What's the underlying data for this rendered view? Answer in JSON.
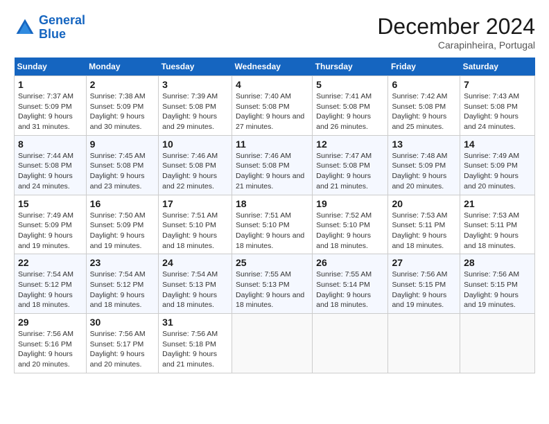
{
  "logo": {
    "line1": "General",
    "line2": "Blue"
  },
  "title": "December 2024",
  "location": "Carapinheira, Portugal",
  "days_header": [
    "Sunday",
    "Monday",
    "Tuesday",
    "Wednesday",
    "Thursday",
    "Friday",
    "Saturday"
  ],
  "weeks": [
    [
      {
        "day": "1",
        "sunrise": "Sunrise: 7:37 AM",
        "sunset": "Sunset: 5:09 PM",
        "daylight": "Daylight: 9 hours and 31 minutes."
      },
      {
        "day": "2",
        "sunrise": "Sunrise: 7:38 AM",
        "sunset": "Sunset: 5:09 PM",
        "daylight": "Daylight: 9 hours and 30 minutes."
      },
      {
        "day": "3",
        "sunrise": "Sunrise: 7:39 AM",
        "sunset": "Sunset: 5:08 PM",
        "daylight": "Daylight: 9 hours and 29 minutes."
      },
      {
        "day": "4",
        "sunrise": "Sunrise: 7:40 AM",
        "sunset": "Sunset: 5:08 PM",
        "daylight": "Daylight: 9 hours and 27 minutes."
      },
      {
        "day": "5",
        "sunrise": "Sunrise: 7:41 AM",
        "sunset": "Sunset: 5:08 PM",
        "daylight": "Daylight: 9 hours and 26 minutes."
      },
      {
        "day": "6",
        "sunrise": "Sunrise: 7:42 AM",
        "sunset": "Sunset: 5:08 PM",
        "daylight": "Daylight: 9 hours and 25 minutes."
      },
      {
        "day": "7",
        "sunrise": "Sunrise: 7:43 AM",
        "sunset": "Sunset: 5:08 PM",
        "daylight": "Daylight: 9 hours and 24 minutes."
      }
    ],
    [
      {
        "day": "8",
        "sunrise": "Sunrise: 7:44 AM",
        "sunset": "Sunset: 5:08 PM",
        "daylight": "Daylight: 9 hours and 24 minutes."
      },
      {
        "day": "9",
        "sunrise": "Sunrise: 7:45 AM",
        "sunset": "Sunset: 5:08 PM",
        "daylight": "Daylight: 9 hours and 23 minutes."
      },
      {
        "day": "10",
        "sunrise": "Sunrise: 7:46 AM",
        "sunset": "Sunset: 5:08 PM",
        "daylight": "Daylight: 9 hours and 22 minutes."
      },
      {
        "day": "11",
        "sunrise": "Sunrise: 7:46 AM",
        "sunset": "Sunset: 5:08 PM",
        "daylight": "Daylight: 9 hours and 21 minutes."
      },
      {
        "day": "12",
        "sunrise": "Sunrise: 7:47 AM",
        "sunset": "Sunset: 5:08 PM",
        "daylight": "Daylight: 9 hours and 21 minutes."
      },
      {
        "day": "13",
        "sunrise": "Sunrise: 7:48 AM",
        "sunset": "Sunset: 5:09 PM",
        "daylight": "Daylight: 9 hours and 20 minutes."
      },
      {
        "day": "14",
        "sunrise": "Sunrise: 7:49 AM",
        "sunset": "Sunset: 5:09 PM",
        "daylight": "Daylight: 9 hours and 20 minutes."
      }
    ],
    [
      {
        "day": "15",
        "sunrise": "Sunrise: 7:49 AM",
        "sunset": "Sunset: 5:09 PM",
        "daylight": "Daylight: 9 hours and 19 minutes."
      },
      {
        "day": "16",
        "sunrise": "Sunrise: 7:50 AM",
        "sunset": "Sunset: 5:09 PM",
        "daylight": "Daylight: 9 hours and 19 minutes."
      },
      {
        "day": "17",
        "sunrise": "Sunrise: 7:51 AM",
        "sunset": "Sunset: 5:10 PM",
        "daylight": "Daylight: 9 hours and 18 minutes."
      },
      {
        "day": "18",
        "sunrise": "Sunrise: 7:51 AM",
        "sunset": "Sunset: 5:10 PM",
        "daylight": "Daylight: 9 hours and 18 minutes."
      },
      {
        "day": "19",
        "sunrise": "Sunrise: 7:52 AM",
        "sunset": "Sunset: 5:10 PM",
        "daylight": "Daylight: 9 hours and 18 minutes."
      },
      {
        "day": "20",
        "sunrise": "Sunrise: 7:53 AM",
        "sunset": "Sunset: 5:11 PM",
        "daylight": "Daylight: 9 hours and 18 minutes."
      },
      {
        "day": "21",
        "sunrise": "Sunrise: 7:53 AM",
        "sunset": "Sunset: 5:11 PM",
        "daylight": "Daylight: 9 hours and 18 minutes."
      }
    ],
    [
      {
        "day": "22",
        "sunrise": "Sunrise: 7:54 AM",
        "sunset": "Sunset: 5:12 PM",
        "daylight": "Daylight: 9 hours and 18 minutes."
      },
      {
        "day": "23",
        "sunrise": "Sunrise: 7:54 AM",
        "sunset": "Sunset: 5:12 PM",
        "daylight": "Daylight: 9 hours and 18 minutes."
      },
      {
        "day": "24",
        "sunrise": "Sunrise: 7:54 AM",
        "sunset": "Sunset: 5:13 PM",
        "daylight": "Daylight: 9 hours and 18 minutes."
      },
      {
        "day": "25",
        "sunrise": "Sunrise: 7:55 AM",
        "sunset": "Sunset: 5:13 PM",
        "daylight": "Daylight: 9 hours and 18 minutes."
      },
      {
        "day": "26",
        "sunrise": "Sunrise: 7:55 AM",
        "sunset": "Sunset: 5:14 PM",
        "daylight": "Daylight: 9 hours and 18 minutes."
      },
      {
        "day": "27",
        "sunrise": "Sunrise: 7:56 AM",
        "sunset": "Sunset: 5:15 PM",
        "daylight": "Daylight: 9 hours and 19 minutes."
      },
      {
        "day": "28",
        "sunrise": "Sunrise: 7:56 AM",
        "sunset": "Sunset: 5:15 PM",
        "daylight": "Daylight: 9 hours and 19 minutes."
      }
    ],
    [
      {
        "day": "29",
        "sunrise": "Sunrise: 7:56 AM",
        "sunset": "Sunset: 5:16 PM",
        "daylight": "Daylight: 9 hours and 20 minutes."
      },
      {
        "day": "30",
        "sunrise": "Sunrise: 7:56 AM",
        "sunset": "Sunset: 5:17 PM",
        "daylight": "Daylight: 9 hours and 20 minutes."
      },
      {
        "day": "31",
        "sunrise": "Sunrise: 7:56 AM",
        "sunset": "Sunset: 5:18 PM",
        "daylight": "Daylight: 9 hours and 21 minutes."
      },
      null,
      null,
      null,
      null
    ]
  ]
}
